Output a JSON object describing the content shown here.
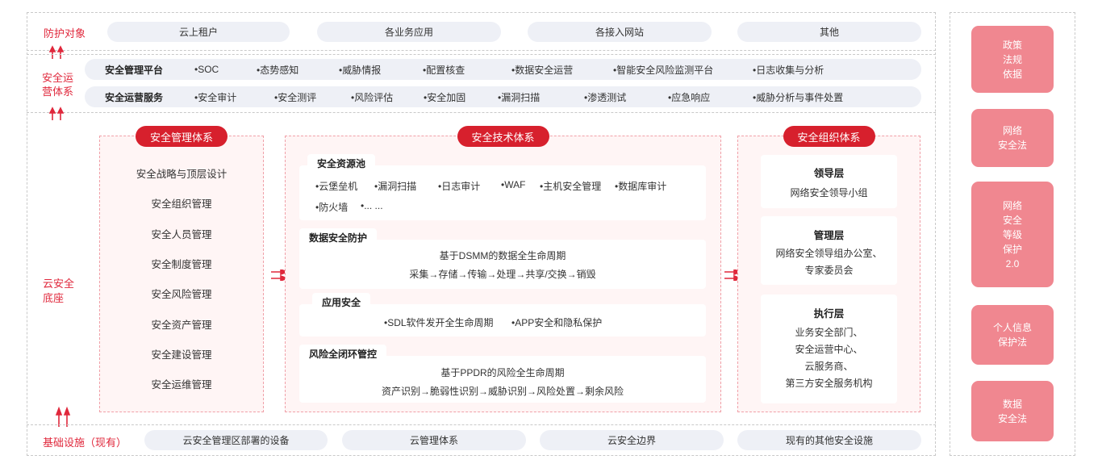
{
  "protection": {
    "label": "防护对象",
    "items": [
      "云上租户",
      "各业务应用",
      "各接入网站",
      "其他"
    ]
  },
  "operations": {
    "label_lines": [
      "安全运",
      "营体系"
    ],
    "platform": {
      "title": "安全管理平台",
      "items": [
        "•SOC",
        "•态势感知",
        "•威胁情报",
        "•配置核查",
        "•数据安全运营",
        "•智能安全风险监测平台",
        "•日志收集与分析"
      ]
    },
    "service": {
      "title": "安全运营服务",
      "items": [
        "•安全审计",
        "•安全测评",
        "•风险评估",
        "•安全加固",
        "•漏洞扫描",
        "•渗透测试",
        "•应急响应",
        "•威胁分析与事件处置"
      ]
    }
  },
  "foundation": {
    "label_lines": [
      "云安全",
      "底座"
    ],
    "management": {
      "title": "安全管理体系",
      "items": [
        "安全战略与顶层设计",
        "安全组织管理",
        "安全人员管理",
        "安全制度管理",
        "安全风险管理",
        "安全资产管理",
        "安全建设管理",
        "安全运维管理"
      ]
    },
    "technology": {
      "title": "安全技术体系",
      "pool": {
        "title": "安全资源池",
        "row1": [
          "•云堡垒机",
          "•漏洞扫描",
          "•日志审计",
          "•WAF",
          "•主机安全管理",
          "•数据库审计"
        ],
        "row2": [
          "•防火墙",
          "•... ..."
        ]
      },
      "data_protection": {
        "title": "数据安全防护",
        "line1": "基于DSMM的数据全生命周期",
        "line2": "采集→存储→传输→处理→共享/交换→销毁"
      },
      "app_security": {
        "title": "应用安全",
        "items": [
          "•SDL软件发开全生命周期",
          "•APP安全和隐私保护"
        ]
      },
      "risk_control": {
        "title": "风险全闭环管控",
        "line1": "基于PPDR的风险全生命周期",
        "line2": "资产识别→脆弱性识别→威胁识别→风险处置→剩余风险"
      }
    },
    "organization": {
      "title": "安全组织体系",
      "leader": {
        "title": "领导层",
        "lines": [
          "网络安全领导小组"
        ]
      },
      "manager": {
        "title": "管理层",
        "lines": [
          "网络安全领导组办公室、",
          "专家委员会"
        ]
      },
      "executor": {
        "title": "执行层",
        "lines": [
          "业务安全部门、",
          "安全运营中心、",
          "云服务商、",
          "第三方安全服务机构"
        ]
      }
    }
  },
  "infrastructure": {
    "label": "基础设施（现有）",
    "items": [
      "云安全管理区部署的设备",
      "云管理体系",
      "云安全边界",
      "现有的其他安全设施"
    ]
  },
  "regulations": [
    {
      "lines": [
        "政策",
        "法规",
        "依据"
      ]
    },
    {
      "lines": [
        "网络",
        "安全法"
      ]
    },
    {
      "lines": [
        "网络",
        "安全",
        "等级",
        "保护",
        "2.0"
      ]
    },
    {
      "lines": [
        "个人信息",
        "保护法"
      ]
    },
    {
      "lines": [
        "数据",
        "安全法"
      ]
    }
  ],
  "colors": {
    "accent": "#d7202d",
    "label_red": "#e0283c",
    "reg_box": "#f08790",
    "pill_bg": "#eef0f6",
    "panel_bg": "#fff5f5"
  }
}
